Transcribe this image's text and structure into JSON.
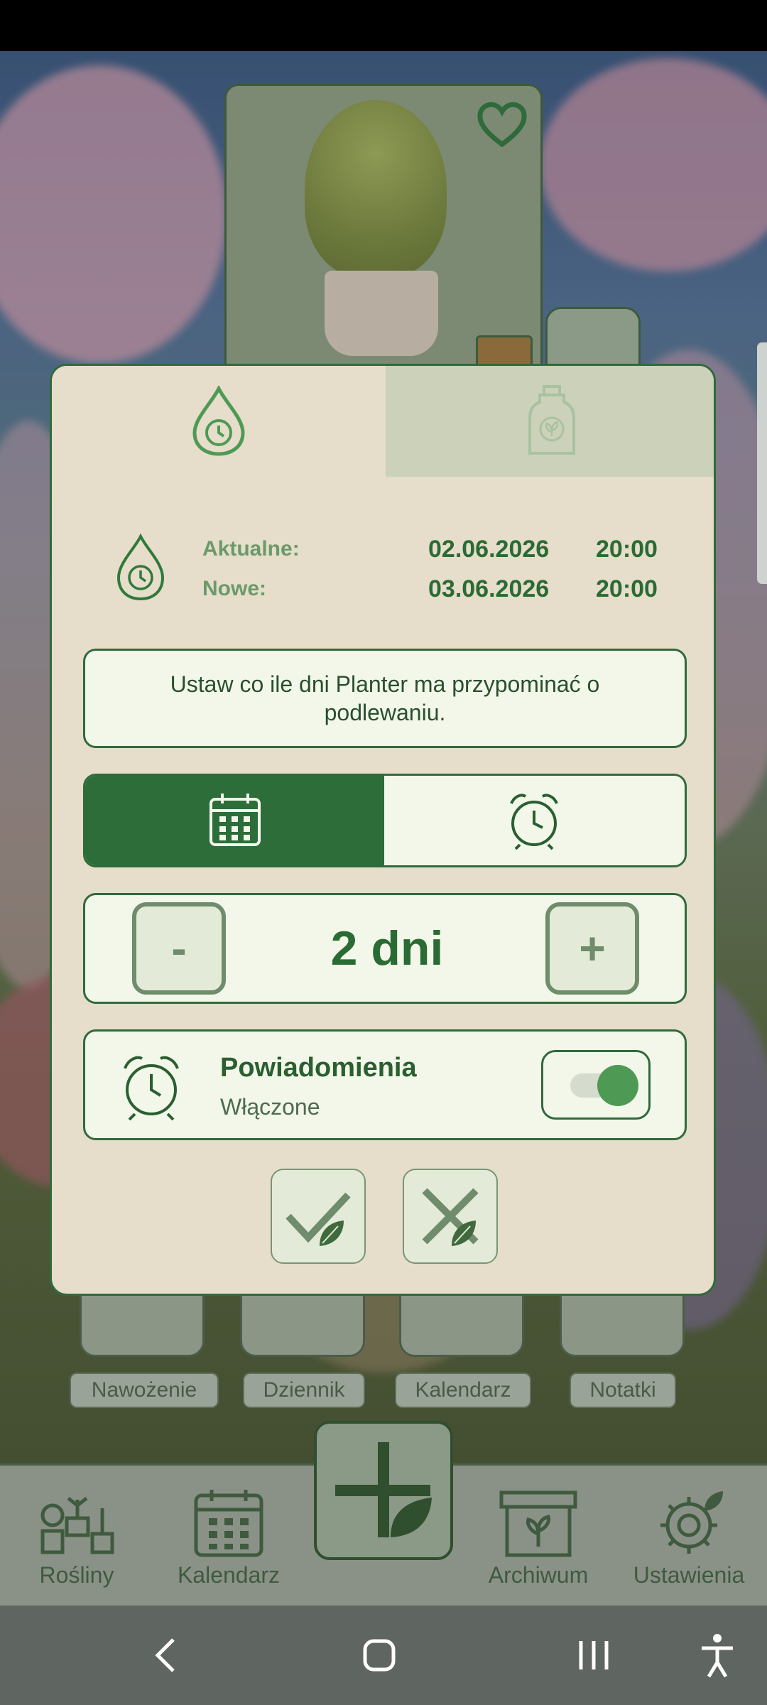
{
  "colors": {
    "accent": "#2d6d3a",
    "panel": "#f2f7ea",
    "dialog_bg": "#e6ddcb",
    "fert_tab": "#ccd1b9"
  },
  "dialog": {
    "tabs": [
      {
        "icon": "water-drop-alarm-icon",
        "active": true
      },
      {
        "icon": "fertilizer-bottle-icon",
        "active": false
      }
    ],
    "dates": {
      "current_label": "Aktualne:",
      "current_date": "02.06.2026",
      "current_time": "20:00",
      "new_label": "Nowe:",
      "new_date": "03.06.2026",
      "new_time": "20:00"
    },
    "info_text": "Ustaw co ile dni Planter ma przypominać o podlewaniu.",
    "mode_segments": [
      {
        "icon": "calendar-icon",
        "active": true
      },
      {
        "icon": "alarm-clock-icon",
        "active": false
      }
    ],
    "stepper": {
      "minus_label": "-",
      "value": "2 dni",
      "plus_label": "+"
    },
    "notifications": {
      "title": "Powiadomienia",
      "status": "Włączone",
      "enabled": true
    },
    "actions": {
      "confirm_icon": "check-leaf-icon",
      "cancel_icon": "cross-leaf-icon"
    }
  },
  "background_tiles": [
    "Nawożenie",
    "Dziennik",
    "Kalendarz",
    "Notatki"
  ],
  "bottom_nav": [
    {
      "label": "Rośliny",
      "icon": "plants-icon"
    },
    {
      "label": "Kalendarz",
      "icon": "calendar-icon"
    },
    {
      "label": "Archiwum",
      "icon": "archive-icon"
    },
    {
      "label": "Ustawienia",
      "icon": "gear-icon"
    }
  ]
}
